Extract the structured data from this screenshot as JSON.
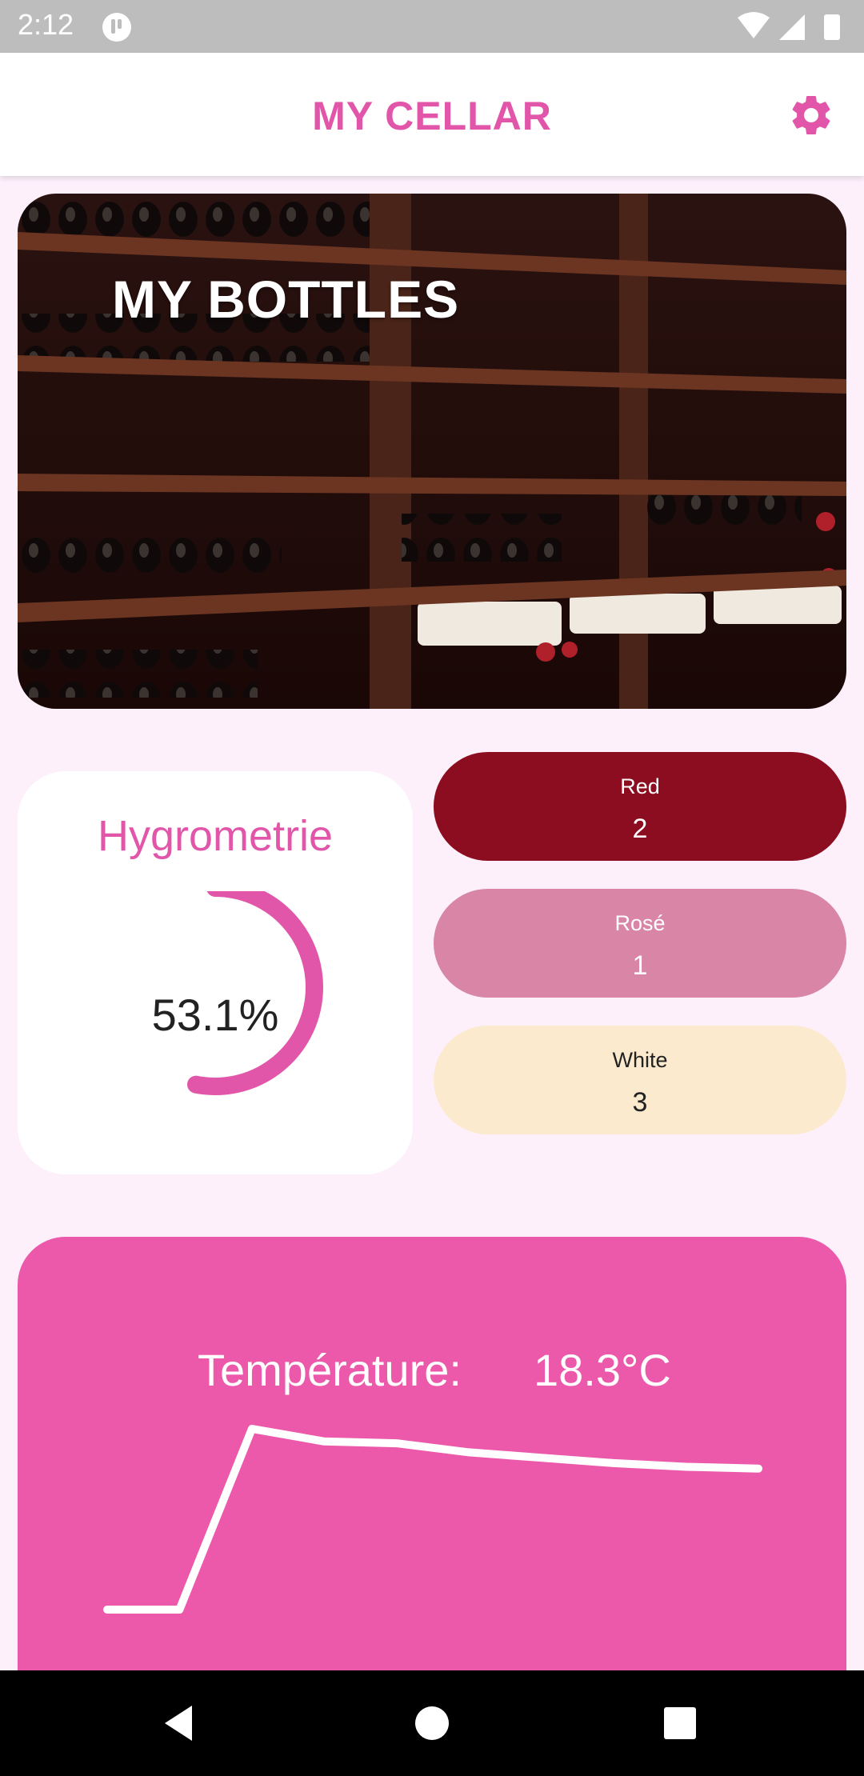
{
  "status_bar": {
    "time": "2:12"
  },
  "app_bar": {
    "title": "MY CELLAR"
  },
  "bottles": {
    "title": "MY BOTTLES"
  },
  "hygrometrie": {
    "title": "Hygrometrie",
    "value_text": "53.1%",
    "value": 53.1
  },
  "wine_types": {
    "red": {
      "label": "Red",
      "count": "2"
    },
    "rose": {
      "label": "Rosé",
      "count": "1"
    },
    "white": {
      "label": "White",
      "count": "3"
    }
  },
  "temperature": {
    "label": "Température:",
    "value": "18.3°C",
    "series": [
      0,
      0,
      100,
      93,
      92,
      87,
      84,
      81,
      79,
      78
    ]
  },
  "colors": {
    "accent": "#e256aa",
    "temp_card": "#ec58aa",
    "red": "#8b0d1f",
    "rose": "#d885a6",
    "white": "#fbeacd"
  },
  "icons": {
    "status_app": "app-notification-icon",
    "wifi": "wifi-icon",
    "signal": "signal-icon",
    "battery": "battery-icon",
    "settings": "gear-icon",
    "back": "back-icon",
    "home": "home-icon",
    "recents": "recents-icon"
  }
}
